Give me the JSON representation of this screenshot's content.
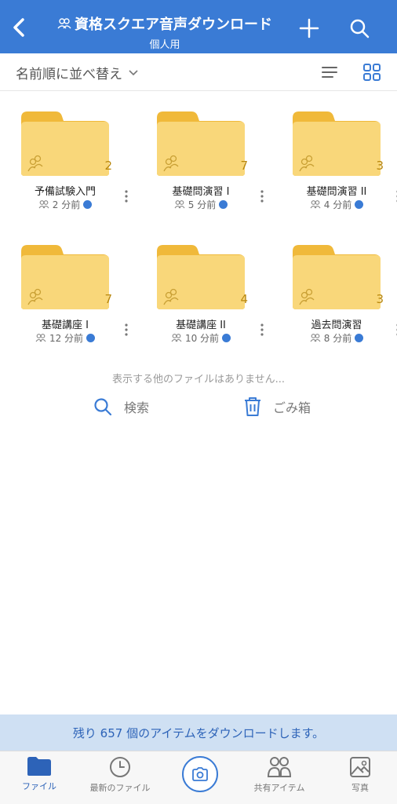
{
  "header": {
    "title": "資格スクエア音声ダウンロード",
    "subtitle": "個人用"
  },
  "sort": {
    "label": "名前順に並べ替え"
  },
  "folders": [
    {
      "name": "予備試験入門",
      "count": "2",
      "meta": "2 分前"
    },
    {
      "name": "基礎問演習 I",
      "count": "7",
      "meta": "5 分前"
    },
    {
      "name": "基礎問演習 II",
      "count": "3",
      "meta": "4 分前"
    },
    {
      "name": "基礎講座 I",
      "count": "7",
      "meta": "12 分前"
    },
    {
      "name": "基礎講座 II",
      "count": "4",
      "meta": "10 分前"
    },
    {
      "name": "過去問演習",
      "count": "3",
      "meta": "8 分前"
    }
  ],
  "empty_message": "表示する他のファイルはありません...",
  "actions": {
    "search": "検索",
    "trash": "ごみ箱"
  },
  "banner": "残り 657 個のアイテムをダウンロードします。",
  "tabs": {
    "files": "ファイル",
    "recent": "最新のファイル",
    "shared": "共有アイテム",
    "photos": "写真"
  },
  "colors": {
    "accent": "#3a7bd5",
    "folder": "#f9d77a",
    "folder_tab": "#f0b93a"
  }
}
